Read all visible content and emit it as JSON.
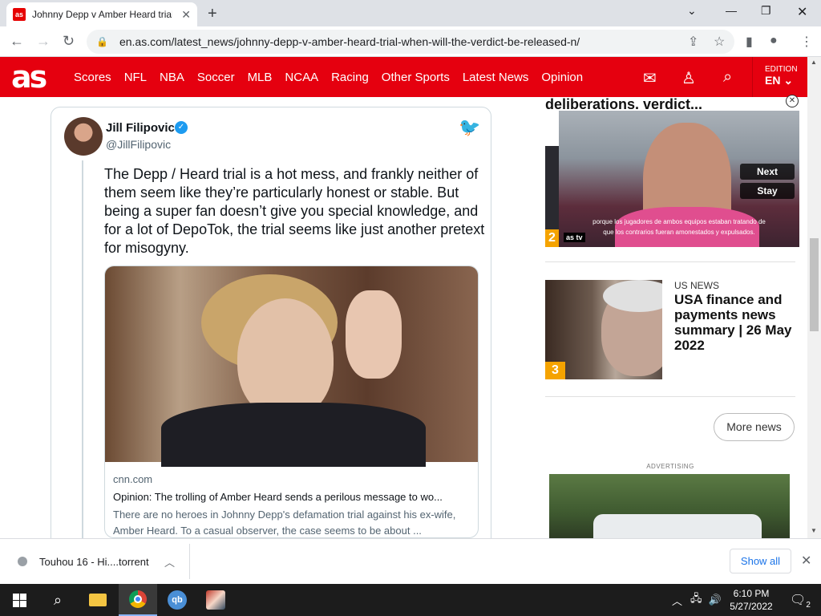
{
  "browser": {
    "tab_title": "Johnny Depp v Amber Heard trial",
    "tab_favicon": "as",
    "url": "en.as.com/latest_news/johnny-depp-v-amber-heard-trial-when-will-the-verdict-be-released-n/"
  },
  "site": {
    "logo": "as",
    "nav": [
      "Scores",
      "NFL",
      "NBA",
      "Soccer",
      "MLB",
      "NCAA",
      "Racing",
      "Other Sports",
      "Latest News",
      "Opinion"
    ],
    "edition_label": "EDITION",
    "edition_value": "EN",
    "brand_color": "#e5000f"
  },
  "tweet": {
    "author": "Jill Filipovic",
    "handle": "@JillFilipovic",
    "text": "The Depp / Heard trial is a hot mess, and frankly neither of them seem like they’re particularly honest or stable. But being a super fan doesn’t give you special knowledge, and for a lot of DepoTok, the trial seems like just another pretext for misogyny.",
    "card": {
      "domain": "cnn.com",
      "title": "Opinion: The trolling of Amber Heard sends a perilous message to wo...",
      "description": "There are no heroes in Johnny Depp's defamation trial against his ex-wife, Amber Heard. To a casual observer, the case seems to be about ..."
    }
  },
  "sidebar": {
    "headline_partial": "deliberations. verdict...",
    "video": {
      "subtitle_line1": "porque los jugadores de ambos equipos estaban tratando de",
      "subtitle_line2": "que los contrarios fueran amonestados y expulsados.",
      "next_label": "Next",
      "stay_label": "Stay",
      "logo": "as tv"
    },
    "rank2": "2",
    "item3": {
      "rank": "3",
      "category": "US NEWS",
      "title": "USA finance and payments news summary | 26 May 2022"
    },
    "more_news": "More news",
    "ad_label": "ADVERTISING"
  },
  "downloads": {
    "file_name": "Touhou 16 - Hi....torrent",
    "show_all": "Show all"
  },
  "taskbar": {
    "time": "6:10 PM",
    "date": "5/27/2022",
    "notifications": "2"
  }
}
